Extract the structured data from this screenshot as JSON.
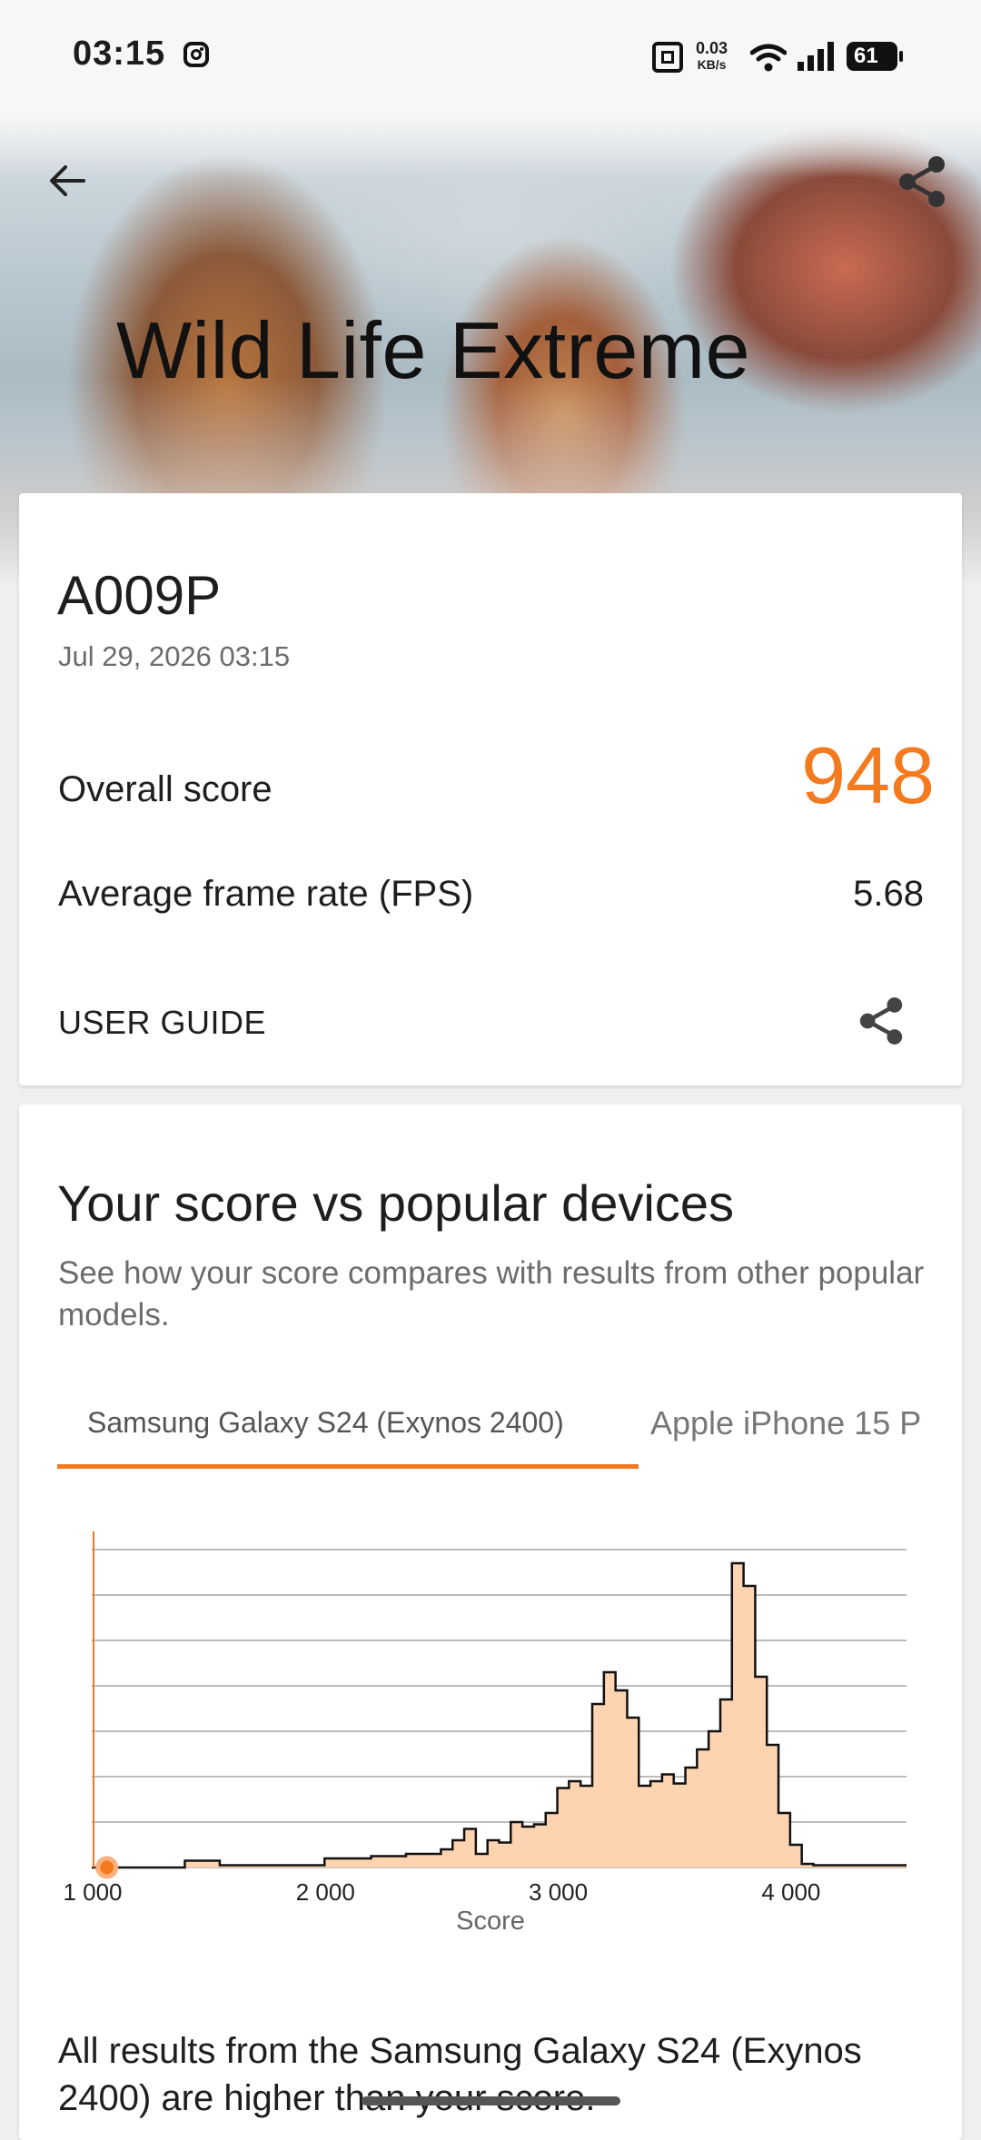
{
  "status_bar": {
    "time": "03:15",
    "net_speed": "0.03",
    "net_unit": "KB/s",
    "battery": "61",
    "icons": [
      "instagram-icon",
      "nfc-icon",
      "wifi-icon",
      "signal-icon",
      "battery-icon"
    ]
  },
  "hero": {
    "title": "Wild Life Extreme",
    "back_icon": "arrow-left-icon",
    "share_icon": "share-icon"
  },
  "result": {
    "device": "A009P",
    "date": "Jul 29, 2026 03:15",
    "overall_label": "Overall score",
    "overall_value": "948",
    "fps_label": "Average frame rate (FPS)",
    "fps_value": "5.68",
    "user_guide": "USER GUIDE",
    "accent": "#f47a20"
  },
  "compare": {
    "title": "Your score vs popular devices",
    "subtitle": "See how your score compares with results from other popular models.",
    "tabs": [
      {
        "label": "Samsung Galaxy S24 (Exynos 2400)",
        "selected": true
      },
      {
        "label": "Apple iPhone 15 P",
        "selected": false
      }
    ],
    "footer": "All results from the Samsung Galaxy S24 (Exynos 2400) are higher than your score."
  },
  "chart_data": {
    "type": "area",
    "xlabel": "Score",
    "ylabel": "",
    "xlim": [
      1000,
      4500
    ],
    "ylim": [
      0,
      7.4
    ],
    "x_ticks": [
      "1 000",
      "2 000",
      "3 000",
      "4 000"
    ],
    "x_tick_values": [
      1000,
      2000,
      3000,
      4000
    ],
    "your_score": 948,
    "fill": "#fdd3b0",
    "stroke": "#111111",
    "series": [
      {
        "x": [
          1000,
          1400,
          1550,
          2000,
          2200,
          2350,
          2500,
          2550,
          2600,
          2650,
          2700,
          2750,
          2800,
          2850,
          2900,
          2950,
          3000,
          3050,
          3100,
          3150,
          3200,
          3250,
          3300,
          3350,
          3400,
          3450,
          3500,
          3550,
          3600,
          3650,
          3700,
          3750,
          3800,
          3850,
          3900,
          3950,
          4000,
          4050,
          4100,
          4150,
          4200,
          4250,
          4300,
          4350,
          4400,
          4450,
          4500
        ],
        "values": [
          0,
          0.15,
          0.05,
          0.2,
          0.25,
          0.3,
          0.4,
          0.6,
          0.85,
          0.3,
          0.6,
          0.55,
          1.0,
          0.9,
          0.95,
          1.2,
          1.75,
          1.9,
          1.8,
          3.6,
          4.3,
          3.9,
          3.3,
          1.8,
          1.9,
          2.05,
          1.85,
          2.2,
          2.6,
          3.0,
          3.7,
          6.7,
          6.2,
          4.2,
          2.7,
          1.2,
          0.5,
          0.08,
          0.05,
          0.05,
          0.05,
          0.05,
          0.05,
          0.05,
          0.05,
          0.05,
          0.05
        ]
      }
    ]
  }
}
